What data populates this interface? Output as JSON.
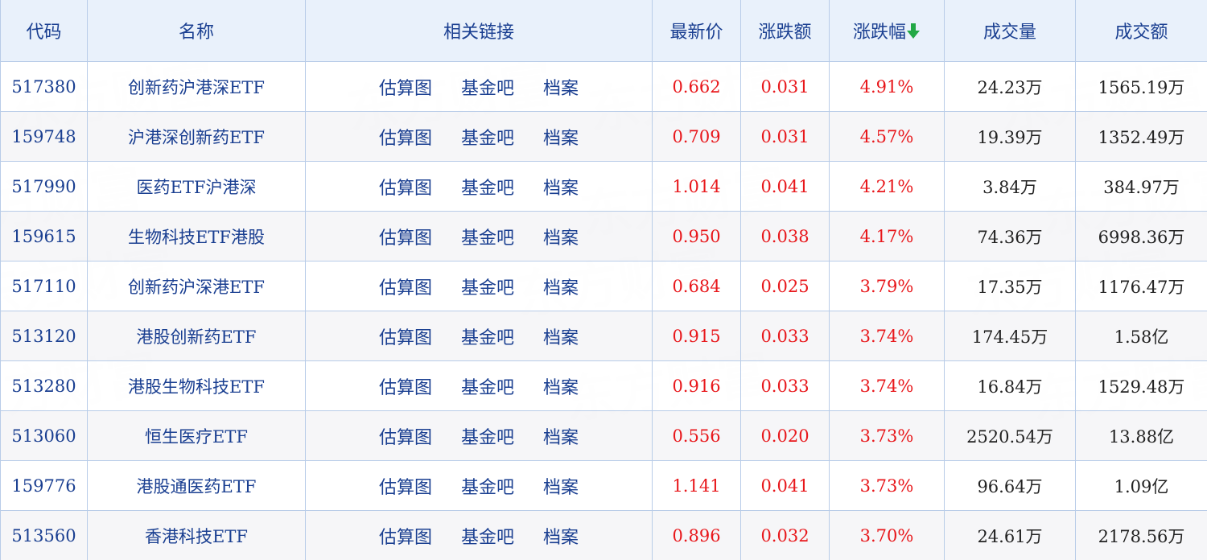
{
  "headers": {
    "code": "代码",
    "name": "名称",
    "links": "相关链接",
    "price": "最新价",
    "change": "涨跌额",
    "pct": "涨跌幅",
    "volume": "成交量",
    "turnover": "成交额"
  },
  "sort": {
    "column": "pct",
    "direction": "desc",
    "icon": "arrow-down-icon",
    "color": "#22a845"
  },
  "link_labels": [
    "估算图",
    "基金吧",
    "档案"
  ],
  "watermark": "东方财富",
  "colors": {
    "up": "#e8171b",
    "link": "#1a3f91",
    "header_bg": "#e9f1fb",
    "border": "#b8cce8"
  },
  "rows": [
    {
      "code": "517380",
      "name": "创新药沪港深ETF",
      "price": "0.662",
      "change": "0.031",
      "pct": "4.91%",
      "volume": "24.23万",
      "turnover": "1565.19万"
    },
    {
      "code": "159748",
      "name": "沪港深创新药ETF",
      "price": "0.709",
      "change": "0.031",
      "pct": "4.57%",
      "volume": "19.39万",
      "turnover": "1352.49万"
    },
    {
      "code": "517990",
      "name": "医药ETF沪港深",
      "price": "1.014",
      "change": "0.041",
      "pct": "4.21%",
      "volume": "3.84万",
      "turnover": "384.97万"
    },
    {
      "code": "159615",
      "name": "生物科技ETF港股",
      "price": "0.950",
      "change": "0.038",
      "pct": "4.17%",
      "volume": "74.36万",
      "turnover": "6998.36万"
    },
    {
      "code": "517110",
      "name": "创新药沪深港ETF",
      "price": "0.684",
      "change": "0.025",
      "pct": "3.79%",
      "volume": "17.35万",
      "turnover": "1176.47万"
    },
    {
      "code": "513120",
      "name": "港股创新药ETF",
      "price": "0.915",
      "change": "0.033",
      "pct": "3.74%",
      "volume": "174.45万",
      "turnover": "1.58亿"
    },
    {
      "code": "513280",
      "name": "港股生物科技ETF",
      "price": "0.916",
      "change": "0.033",
      "pct": "3.74%",
      "volume": "16.84万",
      "turnover": "1529.48万"
    },
    {
      "code": "513060",
      "name": "恒生医疗ETF",
      "price": "0.556",
      "change": "0.020",
      "pct": "3.73%",
      "volume": "2520.54万",
      "turnover": "13.88亿"
    },
    {
      "code": "159776",
      "name": "港股通医药ETF",
      "price": "1.141",
      "change": "0.041",
      "pct": "3.73%",
      "volume": "96.64万",
      "turnover": "1.09亿"
    },
    {
      "code": "513560",
      "name": "香港科技ETF",
      "price": "0.896",
      "change": "0.032",
      "pct": "3.70%",
      "volume": "24.61万",
      "turnover": "2178.56万"
    }
  ]
}
